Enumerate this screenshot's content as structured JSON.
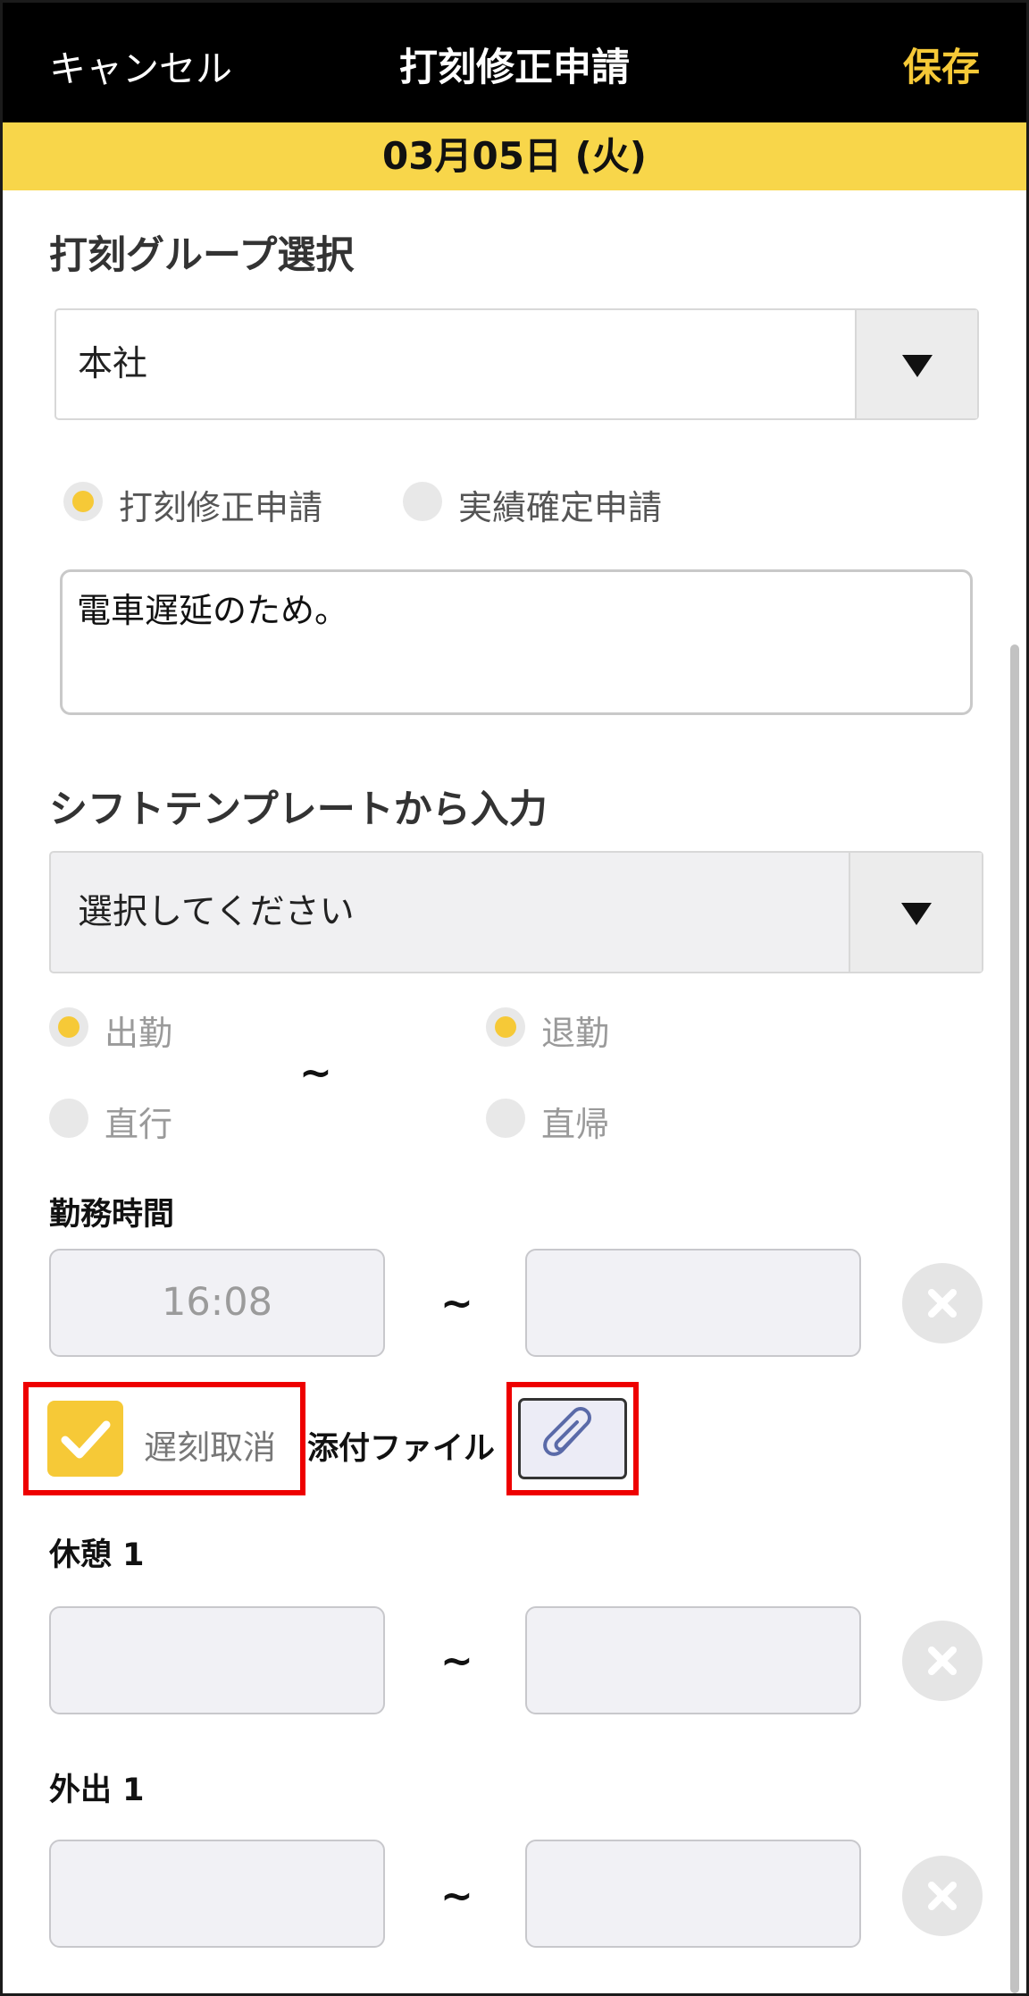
{
  "header": {
    "cancel_label": "キャンセル",
    "title": "打刻修正申請",
    "save_label": "保存"
  },
  "date_bar": "03月05日 (火)",
  "group_section": {
    "title": "打刻グループ選択",
    "selected": "本社"
  },
  "request_type": {
    "options": [
      {
        "label": "打刻修正申請",
        "selected": true
      },
      {
        "label": "実績確定申請",
        "selected": false
      }
    ]
  },
  "reason_text": "電車遅延のため。",
  "shift_template": {
    "title": "シフトテンプレートから入力",
    "selected": "選択してください"
  },
  "punch_options": {
    "left": [
      {
        "label": "出勤",
        "selected": true
      },
      {
        "label": "直行",
        "selected": false
      }
    ],
    "separator": "~",
    "right": [
      {
        "label": "退勤",
        "selected": true
      },
      {
        "label": "直帰",
        "selected": false
      }
    ]
  },
  "work_time": {
    "label": "勤務時間",
    "start": "16:08",
    "end": "",
    "separator": "~"
  },
  "late_cancel": {
    "label": "遅刻取消",
    "checked": true
  },
  "attachment": {
    "label": "添付ファイル"
  },
  "break1": {
    "label": "休憩 1",
    "start": "",
    "end": "",
    "separator": "~"
  },
  "outing1": {
    "label": "外出 1",
    "start": "",
    "end": "",
    "separator": "~"
  },
  "colors": {
    "accent": "#f8d64a",
    "save": "#f6c937",
    "header_bg": "#000000",
    "highlight_box": "#ee0000"
  }
}
